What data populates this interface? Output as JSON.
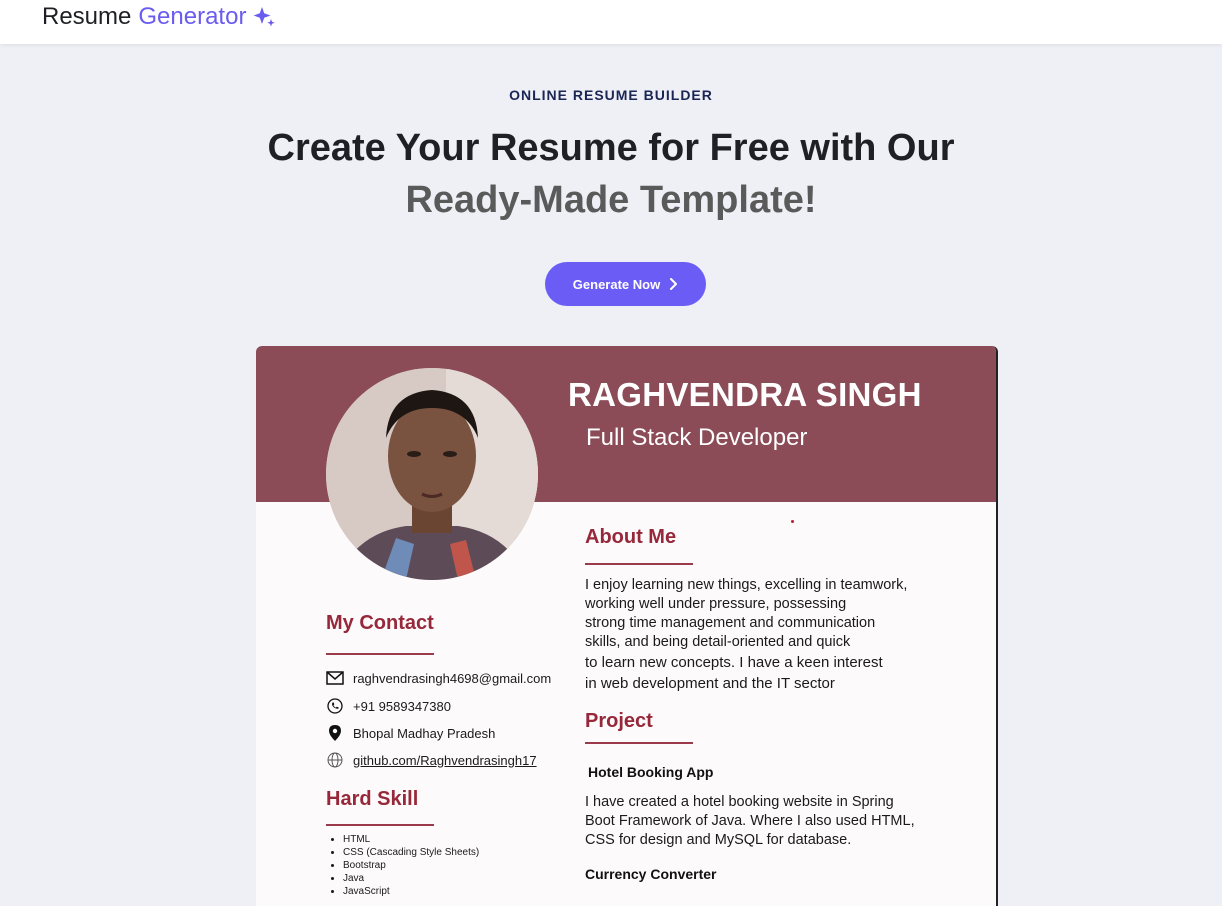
{
  "brand": {
    "word1": "Resume",
    "word2": "Generator",
    "icon": "sparkle-icon",
    "accent": "#6b5cf0"
  },
  "hero": {
    "eyebrow": "ONLINE RESUME BUILDER",
    "headline_line1": "Create Your Resume for Free with Our",
    "headline_line2": "Ready-Made Template!",
    "cta_label": "Generate Now",
    "cta_icon": "chevron-right-icon",
    "cta_color": "#6b5cf5"
  },
  "resume": {
    "header_color": "#8b4c57",
    "name": "RAGHVENDRA SINGH",
    "role": "Full Stack Developer",
    "contact": {
      "title": "My Contact",
      "email": "raghvendrasingh4698@gmail.com",
      "phone": "+91 9589347380",
      "location": "Bhopal Madhay Pradesh",
      "github": "github.com/Raghvendrasingh17"
    },
    "skills": {
      "title": "Hard Skill",
      "items": [
        "HTML",
        "CSS (Cascading Style Sheets)",
        "Bootstrap",
        "Java",
        "JavaScript"
      ]
    },
    "about": {
      "title": "About Me",
      "lines": [
        "I enjoy learning new things, excelling in teamwork,",
        "working well under pressure, possessing",
        "strong time management and communication",
        "skills, and being detail-oriented and quick",
        "to learn new concepts. I have a keen interest",
        "in web development and the IT sector"
      ]
    },
    "project": {
      "title": "Project",
      "items": [
        {
          "name": "Hotel Booking App",
          "lines": [
            "I have created a hotel booking website in Spring",
            "Boot Framework of Java. Where I also used HTML,",
            "CSS for design and MySQL for database."
          ]
        },
        {
          "name": "Currency Converter"
        }
      ]
    }
  }
}
